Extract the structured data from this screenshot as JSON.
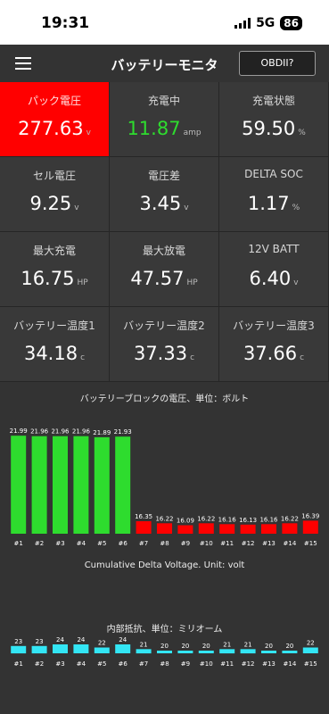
{
  "status": {
    "time": "19:31",
    "network": "5G",
    "battery": "86"
  },
  "header": {
    "title": "バッテリーモニタ",
    "obd_button": "OBDII?"
  },
  "tiles": [
    {
      "label": "パック電圧",
      "value": "277.63",
      "unit": "v",
      "alert": true
    },
    {
      "label": "充電中",
      "value": "11.87",
      "unit": "amp",
      "green": true
    },
    {
      "label": "充電状態",
      "value": "59.50",
      "unit": "%"
    },
    {
      "label": "セル電圧",
      "value": "9.25",
      "unit": "v"
    },
    {
      "label": "電圧差",
      "value": "3.45",
      "unit": "v"
    },
    {
      "label": "DELTA SOC",
      "value": "1.17",
      "unit": "%"
    },
    {
      "label": "最大充電",
      "value": "16.75",
      "unit": "HP"
    },
    {
      "label": "最大放電",
      "value": "47.57",
      "unit": "HP"
    },
    {
      "label": "12V BATT",
      "value": "6.40",
      "unit": "v"
    },
    {
      "label": "バッテリー温度1",
      "value": "34.18",
      "unit": "c"
    },
    {
      "label": "バッテリー温度2",
      "value": "37.33",
      "unit": "c"
    },
    {
      "label": "バッテリー温度3",
      "value": "37.66",
      "unit": "c"
    }
  ],
  "colors": {
    "alert": "#ff0000",
    "green_bar": "#2edc2e",
    "red_bar": "#ff0000",
    "cyan_bar": "#33e6f5",
    "charging_text": "#2edc2e"
  },
  "chart_data": [
    {
      "type": "bar",
      "title": "バッテリーブロックの電圧、単位：ボルト",
      "categories": [
        "#1",
        "#2",
        "#3",
        "#4",
        "#5",
        "#6",
        "#7",
        "#8",
        "#9",
        "#10",
        "#11",
        "#12",
        "#13",
        "#14",
        "#15"
      ],
      "values": [
        21.99,
        21.96,
        21.96,
        21.96,
        21.89,
        21.93,
        16.35,
        16.22,
        16.09,
        16.22,
        16.16,
        16.13,
        16.16,
        16.22,
        16.39
      ],
      "value_labels": [
        "21.99",
        "21.96",
        "21.96",
        "21.96",
        "21.89",
        "21.93",
        "16.35",
        "16.22",
        "16.09",
        "16.22",
        "16.16",
        "16.13",
        "16.16",
        "16.22",
        "16.39"
      ],
      "bar_colors": [
        "#2edc2e",
        "#2edc2e",
        "#2edc2e",
        "#2edc2e",
        "#2edc2e",
        "#2edc2e",
        "#ff0000",
        "#ff0000",
        "#ff0000",
        "#ff0000",
        "#ff0000",
        "#ff0000",
        "#ff0000",
        "#ff0000",
        "#ff0000"
      ],
      "ylim": [
        16.0,
        22.0
      ],
      "grid": false
    },
    {
      "type": "bar",
      "title": "Cumulative Delta Voltage. Unit: volt",
      "categories": [],
      "values": []
    },
    {
      "type": "bar",
      "title": "内部抵抗、単位：ミリオーム",
      "categories": [
        "#1",
        "#2",
        "#3",
        "#4",
        "#5",
        "#6",
        "#7",
        "#8",
        "#9",
        "#10",
        "#11",
        "#12",
        "#13",
        "#14",
        "#15"
      ],
      "values": [
        23,
        23,
        24,
        24,
        22,
        24,
        21,
        20,
        20,
        20,
        21,
        21,
        20,
        20,
        22
      ],
      "value_labels": [
        "23",
        "23",
        "24",
        "24",
        "22",
        "24",
        "21",
        "20",
        "20",
        "20",
        "21",
        "21",
        "20",
        "20",
        "22"
      ],
      "bar_colors": [
        "#33e6f5",
        "#33e6f5",
        "#33e6f5",
        "#33e6f5",
        "#33e6f5",
        "#33e6f5",
        "#33e6f5",
        "#33e6f5",
        "#33e6f5",
        "#33e6f5",
        "#33e6f5",
        "#33e6f5",
        "#33e6f5",
        "#33e6f5",
        "#33e6f5"
      ],
      "ylim": [
        20,
        24
      ],
      "grid": false
    }
  ]
}
